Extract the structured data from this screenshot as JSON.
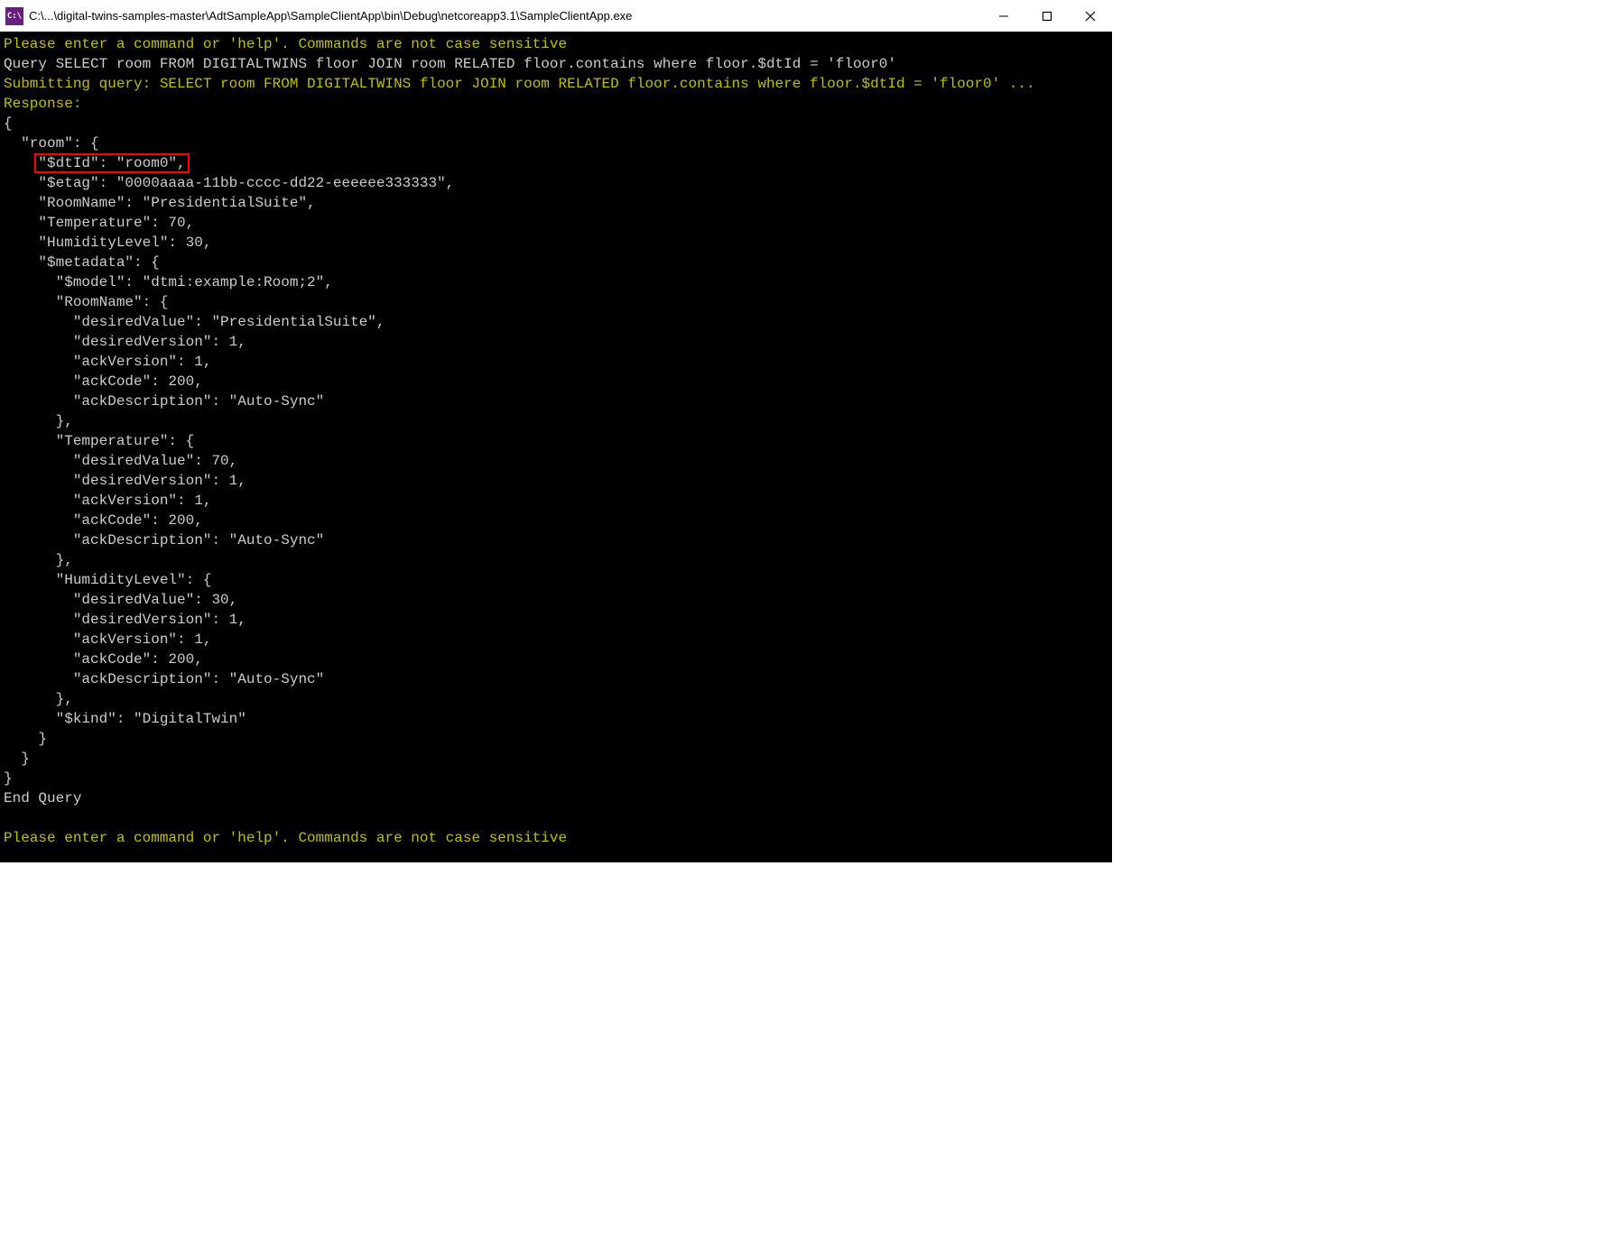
{
  "titlebar": {
    "icon_label": "C:\\",
    "path": "C:\\...\\digital-twins-samples-master\\AdtSampleApp\\SampleClientApp\\bin\\Debug\\netcoreapp3.1\\SampleClientApp.exe"
  },
  "terminal": {
    "lines": [
      {
        "cls": "yellow",
        "text": "Please enter a command or 'help'. Commands are not case sensitive"
      },
      {
        "cls": "white",
        "text": "Query SELECT room FROM DIGITALTWINS floor JOIN room RELATED floor.contains where floor.$dtId = 'floor0'"
      },
      {
        "cls": "yellow",
        "text": "Submitting query: SELECT room FROM DIGITALTWINS floor JOIN room RELATED floor.contains where floor.$dtId = 'floor0' ..."
      },
      {
        "cls": "yellow",
        "text": "Response:"
      },
      {
        "cls": "white",
        "text": "{"
      },
      {
        "cls": "white",
        "text": "  \"room\": {"
      },
      {
        "cls": "white",
        "text": "    ",
        "hl": "\"$dtId\": \"room0\","
      },
      {
        "cls": "white",
        "text": "    \"$etag\": \"0000aaaa-11bb-cccc-dd22-eeeeee333333\","
      },
      {
        "cls": "white",
        "text": "    \"RoomName\": \"PresidentialSuite\","
      },
      {
        "cls": "white",
        "text": "    \"Temperature\": 70,"
      },
      {
        "cls": "white",
        "text": "    \"HumidityLevel\": 30,"
      },
      {
        "cls": "white",
        "text": "    \"$metadata\": {"
      },
      {
        "cls": "white",
        "text": "      \"$model\": \"dtmi:example:Room;2\","
      },
      {
        "cls": "white",
        "text": "      \"RoomName\": {"
      },
      {
        "cls": "white",
        "text": "        \"desiredValue\": \"PresidentialSuite\","
      },
      {
        "cls": "white",
        "text": "        \"desiredVersion\": 1,"
      },
      {
        "cls": "white",
        "text": "        \"ackVersion\": 1,"
      },
      {
        "cls": "white",
        "text": "        \"ackCode\": 200,"
      },
      {
        "cls": "white",
        "text": "        \"ackDescription\": \"Auto-Sync\""
      },
      {
        "cls": "white",
        "text": "      },"
      },
      {
        "cls": "white",
        "text": "      \"Temperature\": {"
      },
      {
        "cls": "white",
        "text": "        \"desiredValue\": 70,"
      },
      {
        "cls": "white",
        "text": "        \"desiredVersion\": 1,"
      },
      {
        "cls": "white",
        "text": "        \"ackVersion\": 1,"
      },
      {
        "cls": "white",
        "text": "        \"ackCode\": 200,"
      },
      {
        "cls": "white",
        "text": "        \"ackDescription\": \"Auto-Sync\""
      },
      {
        "cls": "white",
        "text": "      },"
      },
      {
        "cls": "white",
        "text": "      \"HumidityLevel\": {"
      },
      {
        "cls": "white",
        "text": "        \"desiredValue\": 30,"
      },
      {
        "cls": "white",
        "text": "        \"desiredVersion\": 1,"
      },
      {
        "cls": "white",
        "text": "        \"ackVersion\": 1,"
      },
      {
        "cls": "white",
        "text": "        \"ackCode\": 200,"
      },
      {
        "cls": "white",
        "text": "        \"ackDescription\": \"Auto-Sync\""
      },
      {
        "cls": "white",
        "text": "      },"
      },
      {
        "cls": "white",
        "text": "      \"$kind\": \"DigitalTwin\""
      },
      {
        "cls": "white",
        "text": "    }"
      },
      {
        "cls": "white",
        "text": "  }"
      },
      {
        "cls": "white",
        "text": "}"
      },
      {
        "cls": "white",
        "text": "End Query"
      },
      {
        "cls": "blank",
        "text": ""
      },
      {
        "cls": "yellow",
        "text": "Please enter a command or 'help'. Commands are not case sensitive"
      }
    ]
  }
}
